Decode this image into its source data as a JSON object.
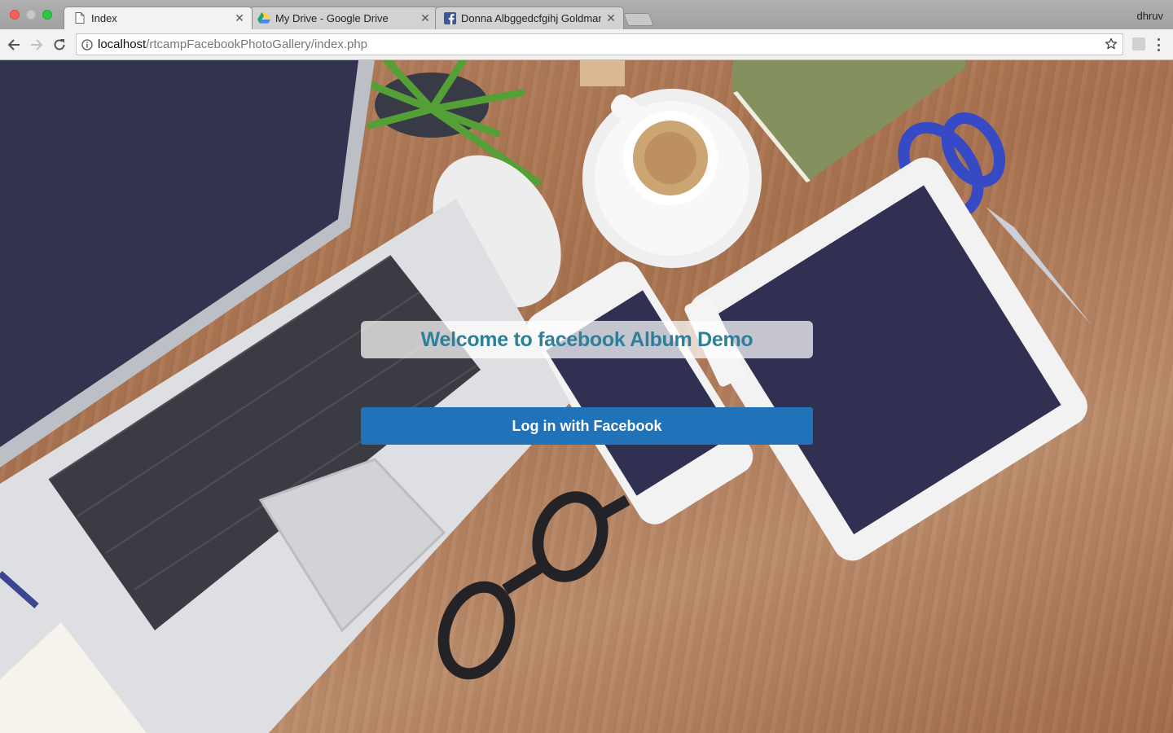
{
  "browser": {
    "tabs": [
      {
        "title": "Index",
        "favicon": "document-icon",
        "active": true
      },
      {
        "title": "My Drive - Google Drive",
        "favicon": "google-drive-icon",
        "active": false
      },
      {
        "title": "Donna Albggedcfgihj Goldman",
        "favicon": "facebook-icon",
        "active": false
      }
    ],
    "profile_name": "dhruv",
    "address_bar": {
      "host": "localhost",
      "path": "/rtcampFacebookPhotoGallery/index.php"
    }
  },
  "page": {
    "welcome_heading": "Welcome to facebook Album Demo",
    "login_button_label": "Log in with Facebook"
  },
  "colors": {
    "heading_text": "#2e7f98",
    "login_button": "#2073b8",
    "facebook_blue": "#3b5998"
  }
}
